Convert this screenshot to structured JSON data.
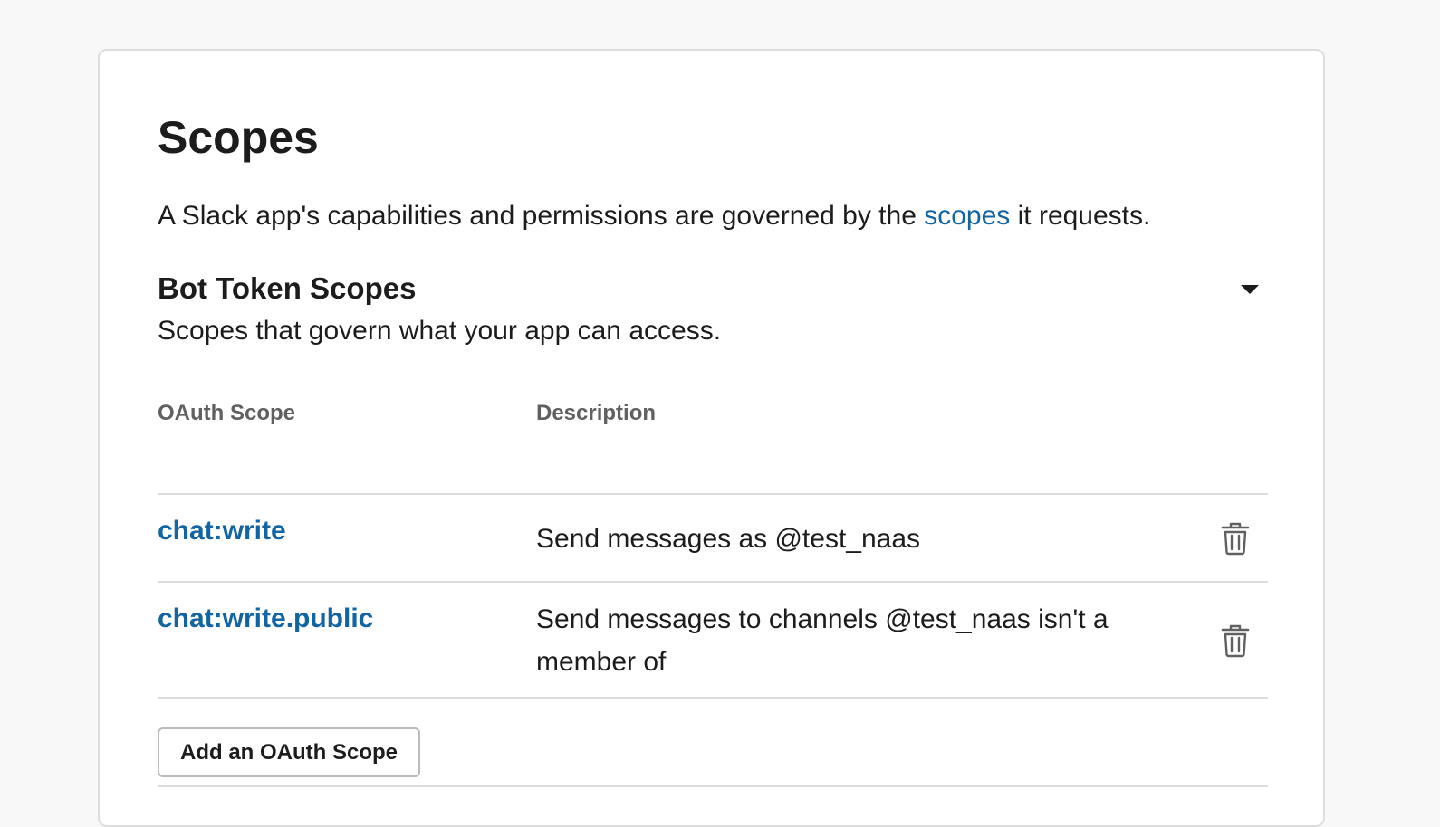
{
  "page": {
    "title": "Scopes",
    "intro_before": "A Slack app's capabilities and permissions are governed by the ",
    "intro_link": "scopes",
    "intro_after": " it requests."
  },
  "bot_token_scopes": {
    "title": "Bot Token Scopes",
    "subtitle": "Scopes that govern what your app can access.",
    "toggle_icon": "caret-down-icon",
    "columns": {
      "scope": "OAuth Scope",
      "description": "Description"
    },
    "rows": [
      {
        "scope": "chat:write",
        "description": "Send messages as @test_naas",
        "remove_icon": "trash-icon"
      },
      {
        "scope": "chat:write.public",
        "description": "Send messages to channels @test_naas isn't a member of",
        "remove_icon": "trash-icon"
      }
    ],
    "add_button": "Add an OAuth Scope"
  },
  "colors": {
    "link": "#1264a3",
    "text": "#1d1c1d",
    "muted": "#616061",
    "divider": "#dddddd",
    "background": "#f8f8f8"
  }
}
